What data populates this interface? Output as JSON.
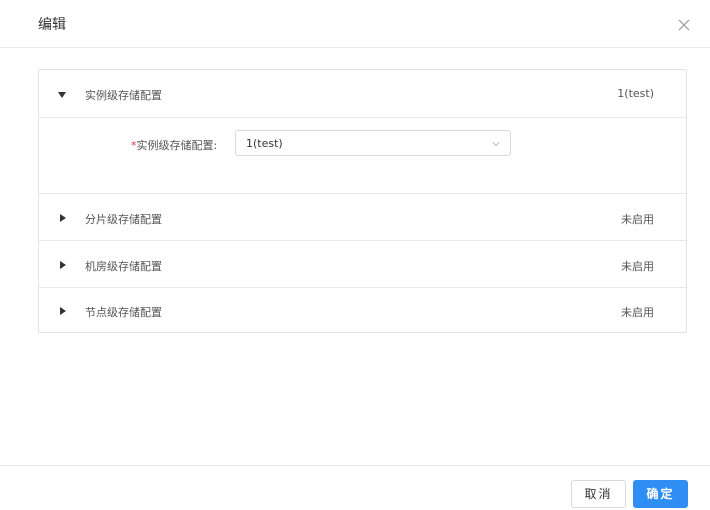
{
  "dialog": {
    "title": "编辑"
  },
  "panel": {
    "sections": [
      {
        "label": "实例级存储配置",
        "value": "1(test)",
        "expanded": true
      },
      {
        "label": "分片级存储配置",
        "value": "未启用",
        "expanded": false
      },
      {
        "label": "机房级存储配置",
        "value": "未启用",
        "expanded": false
      },
      {
        "label": "节点级存储配置",
        "value": "未启用",
        "expanded": false
      }
    ],
    "form": {
      "required_mark": "*",
      "label": "实例级存储配置:",
      "selected": "1(test)"
    }
  },
  "footer": {
    "cancel_label": "取消",
    "ok_label": "确定"
  },
  "colors": {
    "primary": "#2f8ef4",
    "required": "#e0393e",
    "border": "#e3e3e3"
  }
}
